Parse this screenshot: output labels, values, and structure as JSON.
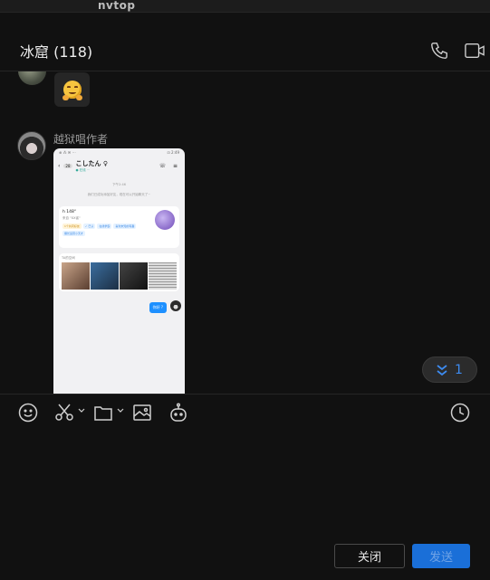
{
  "app": {
    "title": "nvtop"
  },
  "chat": {
    "title": "冰窟 (118)"
  },
  "messages": [
    {
      "type": "emoji",
      "emoji": "hugging-face"
    },
    {
      "type": "image",
      "sender": "越狱唱作者",
      "screenshot": {
        "status_left": "⊕ ⁂ ✉ ⋯",
        "status_right": "⊡ 2:49",
        "badge": "28",
        "nav_title": "こしたん ♀",
        "nav_sub": "● 在线 ⋯",
        "date_text": "下午2:46",
        "system_text": "我们已成功添加好友，现在可以开始聊天了~",
        "card_name": "h      148°",
        "card_loc": "来自 \"XX省\"",
        "tags": [
          "1个共同好友",
          "✓ 已认",
          "在线学霸",
          "喜欢未知的有趣",
          "擅长运营小天才"
        ],
        "album_label": "TA的空间",
        "reply": "你好 ?"
      }
    }
  ],
  "unread": {
    "count": "1"
  },
  "toolbar": {
    "icons": [
      "smiley-icon",
      "scissors-icon",
      "folder-icon",
      "image-icon",
      "robot-icon",
      "clock-icon"
    ]
  },
  "buttons": {
    "close": "关闭",
    "send": "发送"
  },
  "colors": {
    "accent": "#1a6fd8",
    "background": "#111111",
    "unread_text": "#3d8bf0"
  }
}
